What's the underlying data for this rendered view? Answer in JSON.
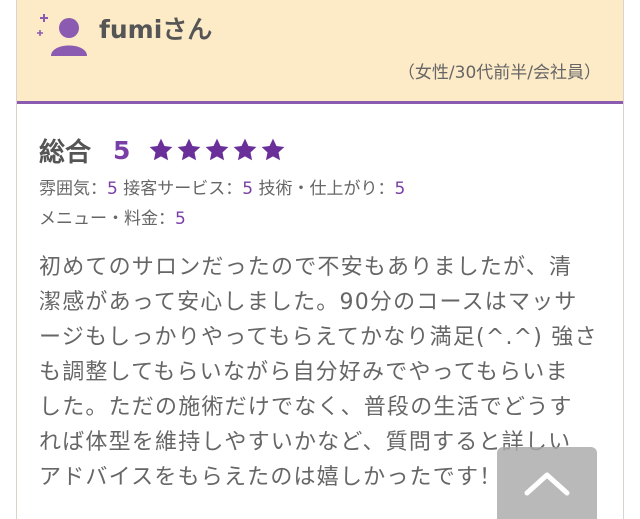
{
  "review": {
    "username": "fumiさん",
    "user_info": "（女性/30代前半/会社員）",
    "overall_label": "総合",
    "overall_score": "5",
    "stars": 5,
    "sub_ratings": {
      "atmosphere_label": "雰囲気：",
      "atmosphere_value": "5",
      "service_label": "接客サービス：",
      "service_value": "5",
      "skill_label": "技術・仕上がり：",
      "skill_value": "5",
      "menu_label": "メニュー・料金：",
      "menu_value": "5"
    },
    "body_lines": [
      "初めてのサロンだったので不安もありましたが、清",
      "潔感があって安心しました。90分のコースはマッサ",
      "ージもしっかりやってもらえてかなり満足(^.^) 強さ",
      "も調整してもらいながら自分好みでやってもらいま",
      "した。ただの施術だけでなく、普段の生活でどうす",
      "れば体型を維持しやすいかなど、質問すると詳しい",
      "アドバイスをもらえたのは嬉しかったです！"
    ]
  },
  "colors": {
    "header_bg": "#fdebc8",
    "accent_purple": "#7a3fa6",
    "text_gray": "#666666"
  },
  "icons": {
    "avatar": "user-avatar-icon",
    "star": "star-icon",
    "back_to_top": "chevron-up-icon"
  }
}
